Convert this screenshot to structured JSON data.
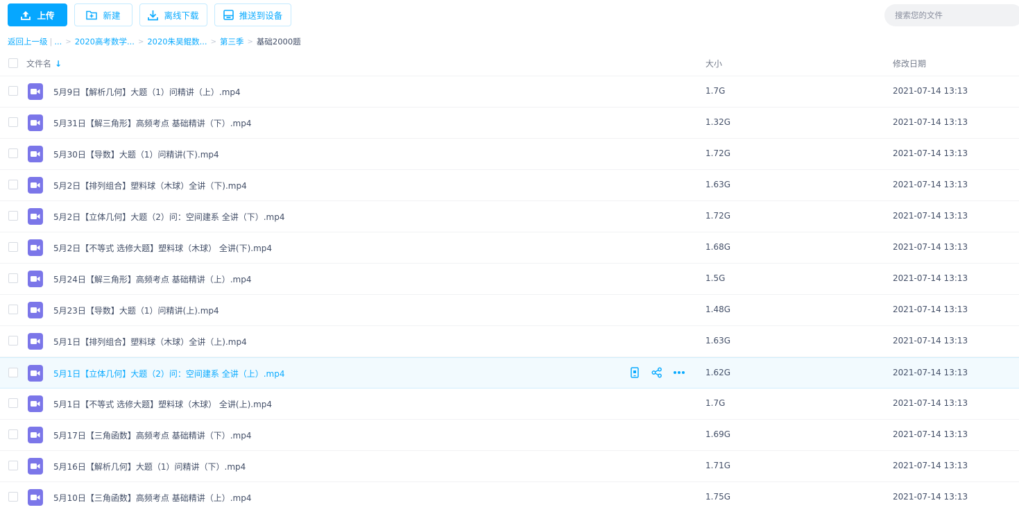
{
  "toolbar": {
    "upload_label": "上传",
    "new_label": "新建",
    "offline_label": "离线下载",
    "push_label": "推送到设备",
    "search_placeholder": "搜索您的文件"
  },
  "breadcrumb": {
    "back": "返回上一级",
    "ellipsis": "...",
    "items": [
      "2020高考数学...",
      "2020朱昊鲲数...",
      "第三季"
    ],
    "current": "基础2000题"
  },
  "table": {
    "col_name": "文件名",
    "col_size": "大小",
    "col_date": "修改日期",
    "sort_arrow": "↓",
    "rows": [
      {
        "name": "5月9日【解析几何】大题（1）问精讲（上）.mp4",
        "size": "1.7G",
        "date": "2021-07-14 13:13"
      },
      {
        "name": "5月31日【解三角形】高频考点 基础精讲（下）.mp4",
        "size": "1.32G",
        "date": "2021-07-14 13:13"
      },
      {
        "name": "5月30日【导数】大题（1）问精讲(下).mp4",
        "size": "1.72G",
        "date": "2021-07-14 13:13"
      },
      {
        "name": "5月2日【排列组合】塑料球（木球）全讲（下).mp4",
        "size": "1.63G",
        "date": "2021-07-14 13:13"
      },
      {
        "name": "5月2日【立体几何】大题（2）问：空间建系 全讲（下）.mp4",
        "size": "1.72G",
        "date": "2021-07-14 13:13"
      },
      {
        "name": "5月2日【不等式 选修大题】塑料球（木球）  全讲(下).mp4",
        "size": "1.68G",
        "date": "2021-07-14 13:13"
      },
      {
        "name": "5月24日【解三角形】高频考点 基础精讲（上）.mp4",
        "size": "1.5G",
        "date": "2021-07-14 13:13"
      },
      {
        "name": "5月23日【导数】大题（1）问精讲(上).mp4",
        "size": "1.48G",
        "date": "2021-07-14 13:13"
      },
      {
        "name": "5月1日【排列组合】塑料球（木球）全讲（上).mp4",
        "size": "1.63G",
        "date": "2021-07-14 13:13"
      },
      {
        "name": "5月1日【立体几何】大题（2）问：空间建系 全讲（上）.mp4",
        "size": "1.62G",
        "date": "2021-07-14 13:13",
        "hover": true
      },
      {
        "name": "5月1日【不等式 选修大题】塑料球（木球）  全讲(上).mp4",
        "size": "1.7G",
        "date": "2021-07-14 13:13"
      },
      {
        "name": "5月17日【三角函数】高频考点 基础精讲（下）.mp4",
        "size": "1.69G",
        "date": "2021-07-14 13:13"
      },
      {
        "name": "5月16日【解析几何】大题（1）问精讲（下）.mp4",
        "size": "1.71G",
        "date": "2021-07-14 13:13"
      },
      {
        "name": "5月10日【三角函数】高频考点 基础精讲（上）.mp4",
        "size": "1.75G",
        "date": "2021-07-14 13:13"
      }
    ]
  },
  "colors": {
    "accent": "#06a7ff",
    "video_icon": "#7b76e9",
    "hover_row": "#f2fafe"
  }
}
